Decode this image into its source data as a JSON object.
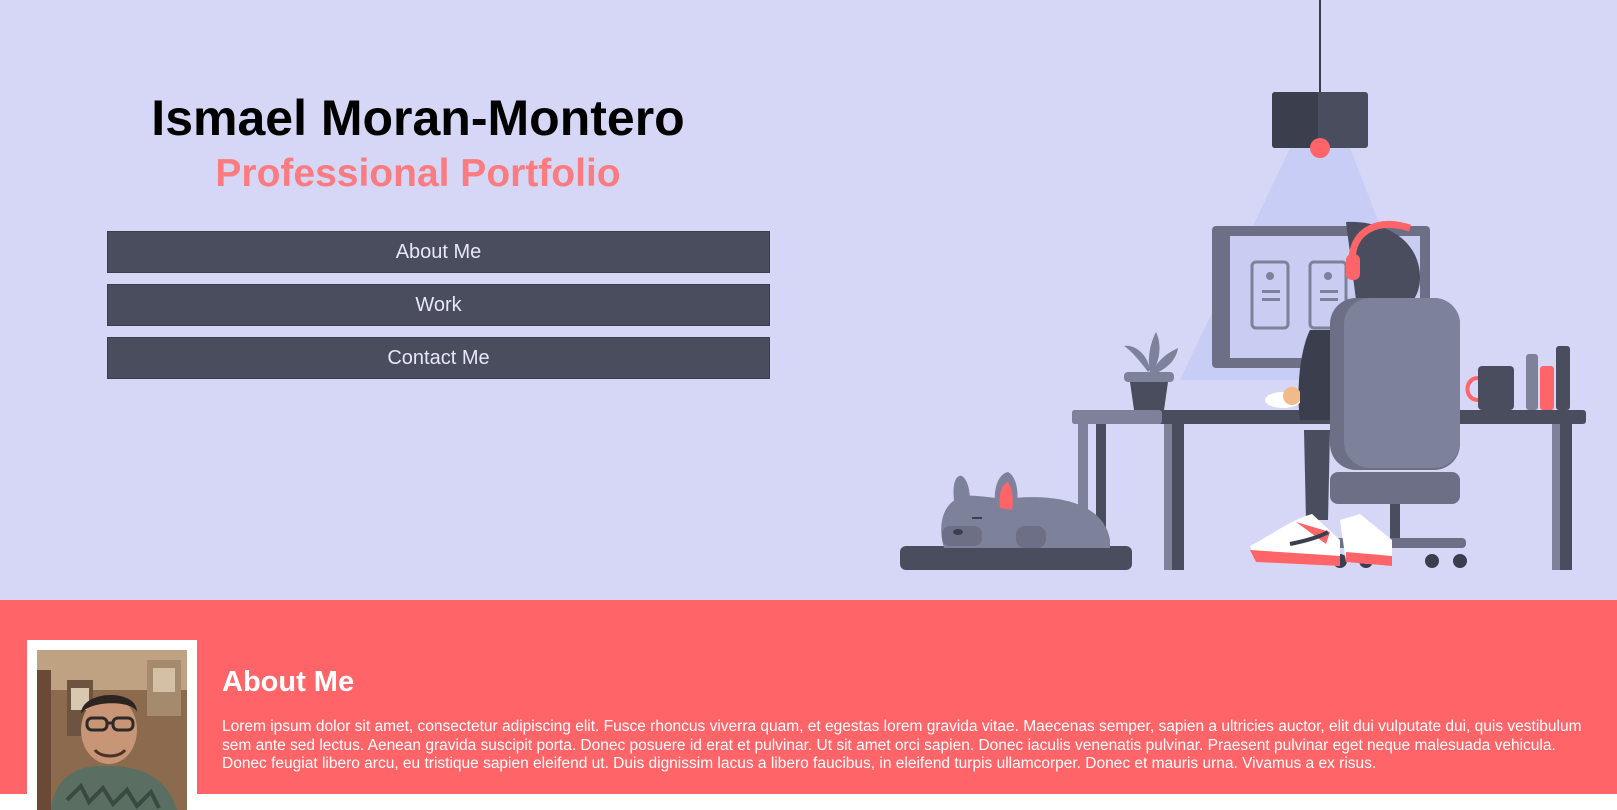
{
  "header": {
    "name": "Ismael Moran-Montero",
    "subtitle": "Professional Portfolio"
  },
  "nav": {
    "items": [
      {
        "label": "About Me"
      },
      {
        "label": "Work"
      },
      {
        "label": "Contact Me"
      }
    ]
  },
  "about": {
    "heading": "About Me",
    "text": "Lorem ipsum dolor sit amet, consectetur adipiscing elit. Fusce rhoncus viverra quam, et egestas lorem gravida vitae. Maecenas semper, sapien a ultricies auctor, elit dui vulputate dui, quis vestibulum sem ante sed lectus. Aenean gravida suscipit porta. Donec posuere id erat et pulvinar. Ut sit amet orci sapien. Donec iaculis venenatis pulvinar. Praesent pulvinar eget neque malesuada vehicula. Donec feugiat libero arcu, eu tristique sapien eleifend ut. Duis dignissim lacus a libero faucibus, in eleifend turpis ullamcorper. Donec et mauris urna. Vivamus a ex risus."
  },
  "colors": {
    "hero_background": "#d6d7f6",
    "accent": "#fa7c80",
    "about_background": "#ff6468",
    "button": "#4a4d5e"
  }
}
